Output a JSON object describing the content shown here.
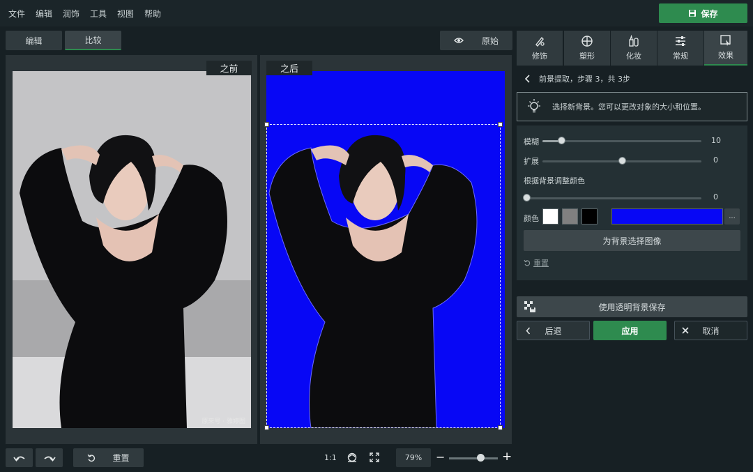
{
  "menu": [
    "文件",
    "编辑",
    "润饰",
    "工具",
    "视图",
    "帮助"
  ],
  "save_label": "保存",
  "view_tabs": {
    "edit": "编辑",
    "compare": "比较"
  },
  "original_label": "原始",
  "before_label": "之前",
  "after_label": "之后",
  "watermark": "原来号 · 雅婷图",
  "tool_tabs": [
    {
      "label": "修饰",
      "icon": "retouch-icon"
    },
    {
      "label": "塑形",
      "icon": "shape-icon"
    },
    {
      "label": "化妆",
      "icon": "makeup-icon"
    },
    {
      "label": "常规",
      "icon": "sliders-icon"
    },
    {
      "label": "效果",
      "icon": "effects-icon"
    }
  ],
  "step_title": "前景提取，步骤 3，共 3步",
  "hint_text": "选择新背景。您可以更改对象的大小和位置。",
  "sliders": {
    "blur": {
      "label": "模糊",
      "value": "10",
      "fraction": 0.12
    },
    "expand": {
      "label": "扩展",
      "value": "0",
      "fraction": 0.5
    },
    "adjust": {
      "label": "根据背景调整颜色",
      "value": "0",
      "fraction": 0.0
    }
  },
  "color_label": "颜色",
  "colors": {
    "white": "#ffffff",
    "gray": "#808080",
    "black": "#000000",
    "selected": "#0707f5"
  },
  "more_label": "...",
  "select_image_label": "为背景选择图像",
  "reset_link": "重置",
  "save_transparent_label": "使用透明背景保存",
  "back_label": "后退",
  "apply_label": "应用",
  "cancel_label": "取消",
  "bottom": {
    "reset_label": "重置",
    "ratio_label": "1:1",
    "zoom": "79%"
  }
}
